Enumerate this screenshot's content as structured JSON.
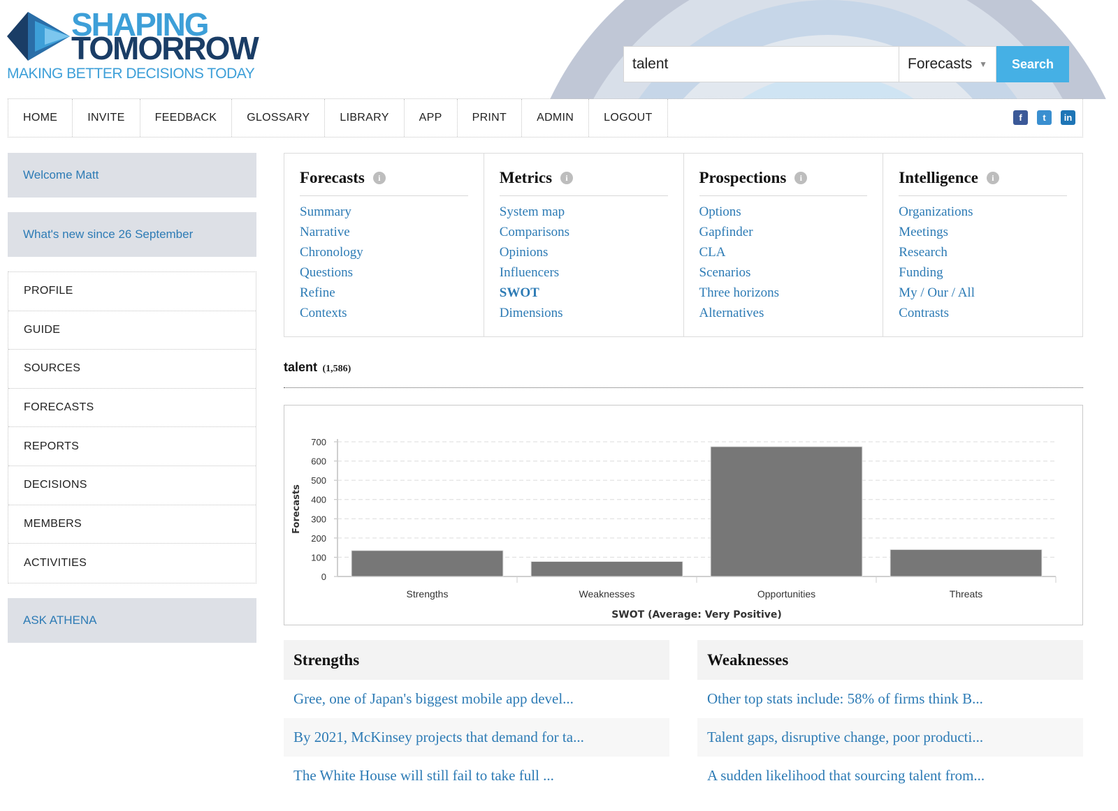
{
  "brand": {
    "line1": "SHAPING",
    "line2": "TOMORROW",
    "tagline": "MAKING BETTER DECISIONS TODAY"
  },
  "search": {
    "value": "talent",
    "scope": "Forecasts",
    "button": "Search"
  },
  "nav": {
    "items": [
      "HOME",
      "INVITE",
      "FEEDBACK",
      "GLOSSARY",
      "LIBRARY",
      "APP",
      "PRINT",
      "ADMIN",
      "LOGOUT"
    ],
    "social": [
      "facebook-icon",
      "twitter-icon",
      "linkedin-icon"
    ]
  },
  "sidebar": {
    "welcome": "Welcome Matt",
    "whats_new": "What's new since 26 September",
    "menu": [
      "PROFILE",
      "GUIDE",
      "SOURCES",
      "FORECASTS",
      "REPORTS",
      "DECISIONS",
      "MEMBERS",
      "ACTIVITIES"
    ],
    "ask": "ASK ATHENA"
  },
  "categories": [
    {
      "title": "Forecasts",
      "links": [
        "Summary",
        "Narrative",
        "Chronology",
        "Questions",
        "Refine",
        "Contexts"
      ]
    },
    {
      "title": "Metrics",
      "links": [
        "System map",
        "Comparisons",
        "Opinions",
        "Influencers",
        "SWOT",
        "Dimensions"
      ],
      "active": "SWOT"
    },
    {
      "title": "Prospections",
      "links": [
        "Options",
        "Gapfinder",
        "CLA",
        "Scenarios",
        "Three horizons",
        "Alternatives"
      ]
    },
    {
      "title": "Intelligence",
      "links": [
        "Organizations",
        "Meetings",
        "Research",
        "Funding",
        "My / Our / All",
        "Contrasts"
      ]
    }
  ],
  "result": {
    "term": "talent",
    "count": "(1,586)"
  },
  "chart_data": {
    "type": "bar",
    "categories": [
      "Strengths",
      "Weaknesses",
      "Opportunities",
      "Threats"
    ],
    "values": [
      135,
      78,
      675,
      140
    ],
    "xlabel": "SWOT (Average: Very Positive)",
    "ylabel": "Forecasts",
    "ylim": [
      0,
      700
    ],
    "yticks": [
      "0",
      "100",
      "200",
      "300",
      "400",
      "500",
      "600",
      "700"
    ],
    "grid": true,
    "bar_color": "#777777"
  },
  "panels": {
    "strengths": {
      "title": "Strengths",
      "items": [
        "Gree, one of Japan's biggest mobile app devel...",
        "By 2021, McKinsey projects that demand for ta...",
        "The White House will still fail to take full ..."
      ]
    },
    "weaknesses": {
      "title": "Weaknesses",
      "items": [
        "Other top stats include: 58% of firms think B...",
        "Talent gaps, disruptive change, poor producti...",
        "A sudden likelihood that sourcing talent from..."
      ]
    }
  },
  "colors": {
    "accent": "#45b0e5",
    "link": "#2d7bb5",
    "sidebar_box": "#dde0e6",
    "logo_dark": "#1a3d66",
    "logo_light": "#3d9fd8"
  }
}
